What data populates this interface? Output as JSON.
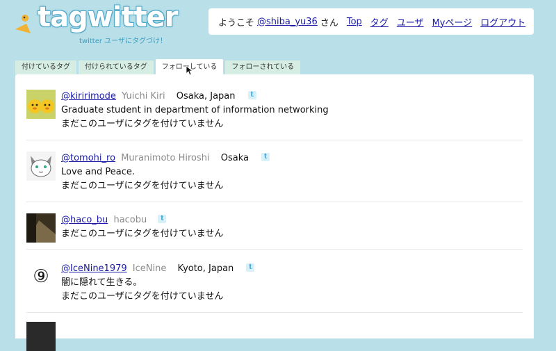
{
  "brand": {
    "logo_text": "tagwitter",
    "tagline": "twitter ユーザにタグづけ！"
  },
  "header": {
    "welcome_prefix": "ようこそ",
    "username": "@shiba_yu36",
    "welcome_suffix": "さん",
    "nav": [
      "Top",
      "タグ",
      "ユーザ",
      "Myページ",
      "ログアウト"
    ]
  },
  "tabs": [
    {
      "label": "付けているタグ",
      "active": false
    },
    {
      "label": "付けられているタグ",
      "active": false
    },
    {
      "label": "フォローしている",
      "active": true
    },
    {
      "label": "フォローされている",
      "active": false
    }
  ],
  "users": [
    {
      "handle": "@kiririmode",
      "name": "Yuichi Kiri",
      "location": "Osaka, Japan",
      "bio": "Graduate student in department of information networking",
      "tag_status": "まだこのユーザにタグを付けていません"
    },
    {
      "handle": "@tomohi_ro",
      "name": "Muranimoto Hiroshi",
      "location": "Osaka",
      "bio": "Love and Peace.",
      "tag_status": "まだこのユーザにタグを付けていません"
    },
    {
      "handle": "@haco_bu",
      "name": "hacobu",
      "location": "",
      "bio": "",
      "tag_status": "まだこのユーザにタグを付けていません"
    },
    {
      "handle": "@IceNine1979",
      "name": "IceNine",
      "location": "Kyoto, Japan",
      "bio": "闇に隠れて生きる。",
      "tag_status": "まだこのユーザにタグを付けていません",
      "avatar_glyph": "⑨"
    }
  ],
  "icons": {
    "twitter": "twitter-icon",
    "bird": "bird-logo-icon",
    "cursor": "mouse-cursor-icon"
  },
  "colors": {
    "background": "#b9e0e8",
    "link": "#1a1aa6",
    "tab_inactive": "#d6ede3",
    "logo_stroke": "#4fa7c8"
  }
}
